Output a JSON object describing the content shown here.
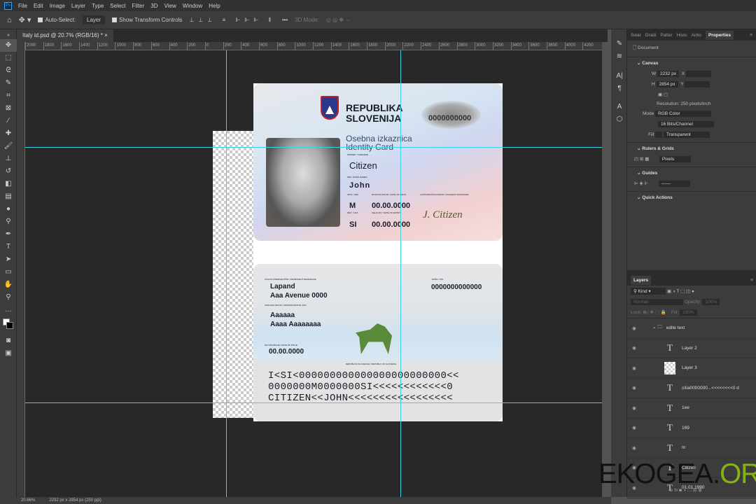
{
  "menu": [
    "File",
    "Edit",
    "Image",
    "Layer",
    "Type",
    "Select",
    "Filter",
    "3D",
    "View",
    "Window",
    "Help"
  ],
  "options": {
    "auto_select": "Auto-Select:",
    "layer": "Layer",
    "show_transform": "Show Transform Controls",
    "more": "•••",
    "mode3d": "3D Mode:"
  },
  "tab": "Italy id.psd @ 20.7% (RGB/16) *",
  "tab_close": "×",
  "ruler": [
    "2000",
    "1800",
    "1600",
    "1400",
    "1200",
    "1000",
    "800",
    "600",
    "400",
    "200",
    "0",
    "200",
    "400",
    "600",
    "800",
    "1000",
    "1200",
    "1400",
    "1600",
    "1800",
    "2000",
    "2200",
    "2400",
    "2600",
    "2800",
    "3000",
    "3200",
    "3400",
    "3600",
    "3800",
    "4000",
    "4200"
  ],
  "card_front": {
    "country1": "REPUBLIKA",
    "country2": "SLOVENIJA",
    "number": "0000000000",
    "title1": "Osebna izkaznica",
    "title2": "Identity Card",
    "surname_label": "PRIIMEK / SURNAME",
    "surname": "Citizen",
    "name_label": "IME / GIVEN NAMES",
    "name": "John",
    "sex_label": "SPOL / SEX",
    "sex": "M",
    "dob_label": "ROJSTNI DATUM / DATE OF BIRTH",
    "dob": "00.00.0000",
    "nat_label": "DRŽ. / NAT.",
    "nat": "SI",
    "exp_label": "VELJA DO / DATE OF EXPIRY",
    "exp": "00.00.0000",
    "sig_label": "LASTNOROČNI PODPIS / HOLDER'S SIGNATURE",
    "signature": "J. Citizen"
  },
  "card_back": {
    "res_label": "STALNO PREBIVALIŠČE / PERMANENT RESIDENCE",
    "res1": "Lapand",
    "res2": "Aaa Avenue 0000",
    "emso_label": "EMŠO / PIN",
    "emso": "0000000000000",
    "unit_label": "UPRAVNA ENOTA / ADMINISTRATIVE UNIT",
    "unit1": "Aaaaaa",
    "unit2": "Aaaa Aaaaaaaa",
    "issue_label": "DATUM IZDAJE / DATE OF ISSUE",
    "issue": "00.00.0000",
    "footer": "REPUBLIKA SLOVENIJA / REPUBLIC OF SLOVENIA",
    "mrz1": "I<SI<000000000000000000000000<<",
    "mrz2": "0000000M0000000SI<<<<<<<<<<<<0",
    "mrz3": "CITIZEN<<JOHN<<<<<<<<<<<<<<<<<"
  },
  "panel_tabs": [
    "Swat",
    "Gradi",
    "Patter",
    "Histo",
    "Actio",
    "Properties"
  ],
  "props": {
    "document": "Document",
    "canvas": "Canvas",
    "w_label": "W",
    "w": "2232 px",
    "h_label": "H",
    "h": "2854 px",
    "x_label": "X",
    "y_label": "Y",
    "resolution": "Resolution: 250 pixels/inch",
    "mode_label": "Mode",
    "mode": "RGB Color",
    "depth": "16 Bits/Channel",
    "fill_label": "Fill",
    "fill": "Transparent",
    "rulers": "Rulers & Grids",
    "units": "Pixels",
    "guides": "Guides",
    "quick": "Quick Actions"
  },
  "layers": {
    "title": "Layers",
    "kind": "Kind",
    "blend": "Normal",
    "opacity_label": "Opacity:",
    "opacity": "100%",
    "lock_label": "Lock:",
    "fill_label": "Fill:",
    "fill": "100%",
    "items": [
      {
        "name": "edite text",
        "type": "group"
      },
      {
        "name": "Layer 2",
        "type": "text"
      },
      {
        "name": "Layer 3",
        "type": "image"
      },
      {
        "name": "citia0000000...<<<<<<<<0 d",
        "type": "text"
      },
      {
        "name": "1ee",
        "type": "text"
      },
      {
        "name": "169",
        "type": "text"
      },
      {
        "name": "m",
        "type": "text"
      },
      {
        "name": "Citizen",
        "type": "text"
      },
      {
        "name": "01.01.1990",
        "type": "text"
      }
    ]
  },
  "status": {
    "zoom": "20.66%",
    "size": "2232 px x 2854 px (250 ppi)"
  },
  "watermark": {
    "a": "EKOGEA.",
    "b": "ORG"
  },
  "colors": {
    "guide": "#3ad2e6",
    "wm_green": "#86b314"
  }
}
